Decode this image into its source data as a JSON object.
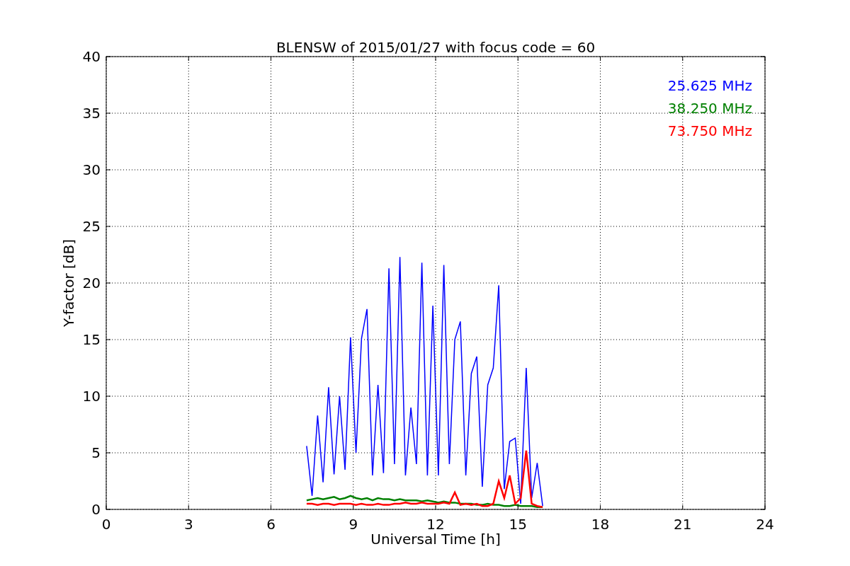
{
  "figure": {
    "chart_data": {
      "type": "line",
      "title": "BLENSW of 2015/01/27 with focus code = 60",
      "xlabel": "Universal Time [h]",
      "ylabel": "Y-factor [dB]",
      "x": [
        7.3,
        7.5,
        7.7,
        7.9,
        8.1,
        8.3,
        8.5,
        8.7,
        8.9,
        9.1,
        9.3,
        9.5,
        9.7,
        9.9,
        10.1,
        10.3,
        10.5,
        10.7,
        10.9,
        11.1,
        11.3,
        11.5,
        11.7,
        11.9,
        12.1,
        12.3,
        12.5,
        12.7,
        12.9,
        13.1,
        13.3,
        13.5,
        13.7,
        13.9,
        14.1,
        14.3,
        14.5,
        14.7,
        14.9,
        15.1,
        15.3,
        15.5,
        15.7,
        15.9
      ],
      "series": [
        {
          "name": "25.625 MHz",
          "color": "#0000ff",
          "values": [
            5.6,
            1.2,
            8.3,
            2.4,
            10.8,
            3.1,
            10.0,
            3.5,
            15.2,
            5.0,
            15.1,
            17.7,
            3.0,
            11.0,
            3.2,
            21.3,
            4.0,
            22.3,
            3.0,
            9.0,
            4.0,
            21.8,
            3.0,
            18.0,
            3.0,
            21.6,
            4.0,
            15.0,
            16.6,
            3.0,
            12.0,
            13.5,
            2.0,
            11.0,
            12.5,
            19.8,
            1.8,
            6.0,
            6.3,
            0.5,
            12.5,
            1.0,
            4.1,
            0.3
          ]
        },
        {
          "name": "38.250 MHz",
          "color": "#008000",
          "values": [
            0.8,
            0.9,
            1.0,
            0.9,
            1.0,
            1.1,
            0.9,
            1.0,
            1.2,
            1.0,
            0.9,
            1.0,
            0.8,
            1.0,
            0.9,
            0.9,
            0.8,
            0.9,
            0.8,
            0.8,
            0.8,
            0.7,
            0.8,
            0.7,
            0.6,
            0.7,
            0.6,
            0.6,
            0.5,
            0.5,
            0.5,
            0.4,
            0.4,
            0.5,
            0.4,
            0.4,
            0.3,
            0.3,
            0.4,
            0.3,
            0.3,
            0.3,
            0.2,
            0.2
          ]
        },
        {
          "name": "73.750 MHz",
          "color": "#ff0000",
          "values": [
            0.5,
            0.5,
            0.4,
            0.5,
            0.5,
            0.4,
            0.5,
            0.5,
            0.5,
            0.4,
            0.5,
            0.4,
            0.4,
            0.5,
            0.4,
            0.4,
            0.5,
            0.5,
            0.6,
            0.5,
            0.5,
            0.6,
            0.5,
            0.5,
            0.5,
            0.6,
            0.5,
            1.5,
            0.4,
            0.5,
            0.4,
            0.5,
            0.3,
            0.3,
            0.5,
            2.5,
            1.0,
            3.0,
            0.5,
            1.0,
            5.2,
            0.5,
            0.3,
            0.2
          ]
        }
      ],
      "grid": true,
      "xlim": [
        0,
        24
      ],
      "ylim": [
        0,
        40
      ],
      "xticks": [
        0,
        3,
        6,
        9,
        12,
        15,
        18,
        21,
        24
      ],
      "yticks": [
        0,
        5,
        10,
        15,
        20,
        25,
        30,
        35,
        40
      ]
    }
  }
}
